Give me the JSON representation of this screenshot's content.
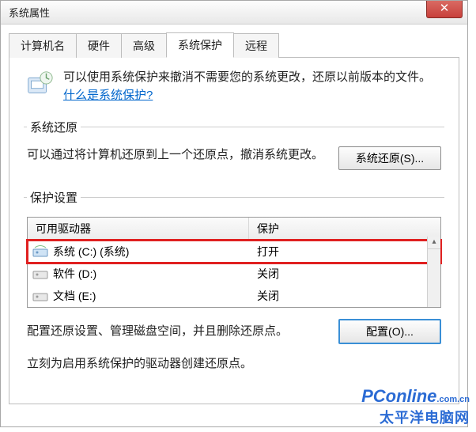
{
  "window": {
    "title": "系统属性"
  },
  "close_glyph": "✕",
  "tabs": [
    {
      "label": "计算机名"
    },
    {
      "label": "硬件"
    },
    {
      "label": "高级"
    },
    {
      "label": "系统保护"
    },
    {
      "label": "远程"
    }
  ],
  "intro": {
    "text_prefix": "可以使用系统保护来撤消不需要您的系统更改，还原以前版本的文件。",
    "link": "什么是系统保护?"
  },
  "restore": {
    "legend": "系统还原",
    "desc": "可以通过将计算机还原到上一个还原点，撤消系统更改。",
    "button": "系统还原(S)..."
  },
  "protect": {
    "legend": "保护设置",
    "header_drive": "可用驱动器",
    "header_status": "保护",
    "rows": [
      {
        "name": "系统 (C:) (系统)",
        "status": "打开",
        "icon": "sys"
      },
      {
        "name": "软件 (D:)",
        "status": "关闭",
        "icon": "hdd"
      },
      {
        "name": "文档 (E:)",
        "status": "关闭",
        "icon": "hdd"
      }
    ],
    "config_desc": "配置还原设置、管理磁盘空间，并且删除还原点。",
    "config_button": "配置(O)...",
    "create_desc": "立刻为启用系统保护的驱动器创建还原点。"
  },
  "watermark": {
    "brand": "PConline",
    "tld": ".com.cn",
    "cn": "太平洋电脑网"
  }
}
